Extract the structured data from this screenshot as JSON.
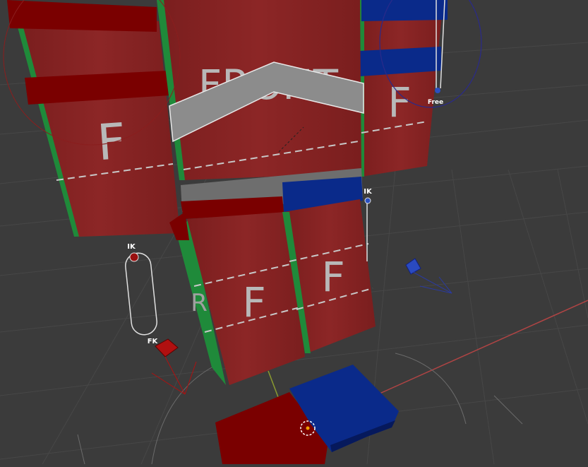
{
  "viewport": {
    "labels": {
      "torso_front": "FRONT",
      "left_arm_face": "F",
      "right_arm_face": "F",
      "left_leg_face": "F",
      "right_leg_face": "F",
      "left_leg_side": "R"
    },
    "switch_labels": {
      "left_ik": "IK",
      "left_fk": "FK",
      "right_ik": "IK",
      "arm_free": "Free"
    },
    "colors": {
      "background": "#3b3b3b",
      "grid": "#4a4a4a",
      "body_red": "#8a2424",
      "band_red": "#7a0000",
      "band_blue": "#0a2a8a",
      "side_green": "#1f8a3a",
      "select_gray": "#8c8c8c",
      "axis_x": "#b04444",
      "axis_y": "#8a9a30"
    },
    "icons": [
      "ik-fk-switch-icon",
      "bone-control-icon",
      "3d-cursor-icon",
      "rotation-gizmo-icon"
    ]
  }
}
